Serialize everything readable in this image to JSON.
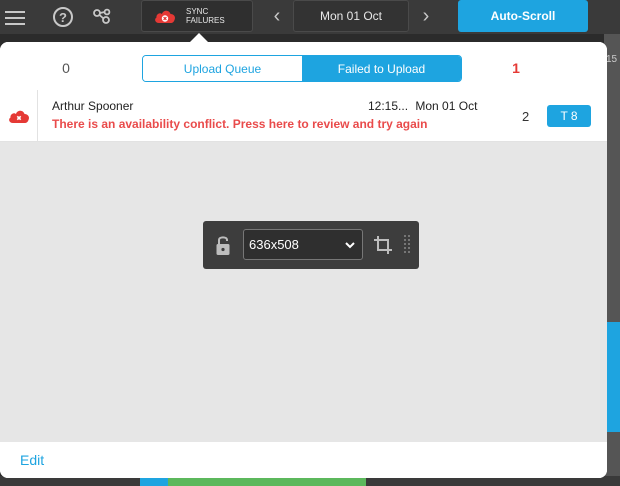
{
  "topbar": {
    "sync_label_line1": "SYNC",
    "sync_label_line2": "FAILURES",
    "date": "Mon 01 Oct",
    "autoscroll_label": "Auto-Scroll",
    "accent_color": "#1ea4e0"
  },
  "background": {
    "right_edge_text": "15"
  },
  "panel": {
    "count_left": "0",
    "count_right": "1",
    "tabs": [
      {
        "label": "Upload Queue",
        "active": false
      },
      {
        "label": "Failed to Upload",
        "active": true
      }
    ],
    "rows": [
      {
        "name": "Arthur Spooner",
        "time": "12:15...",
        "date": "Mon 01 Oct",
        "error": "There is an availability conflict. Press here to review and try again",
        "count": "2",
        "badge": "T 8",
        "icon": "cloud-error-icon"
      }
    ],
    "footer_edit": "Edit"
  },
  "floating_toolbar": {
    "size_value": "636x508",
    "icons": [
      "unlock-icon",
      "chevron-down-icon",
      "crop-icon",
      "grip-icon"
    ]
  },
  "colors": {
    "error_red": "#e94b4b",
    "accent_blue": "#1ea4e0",
    "count_red": "#e53935"
  }
}
